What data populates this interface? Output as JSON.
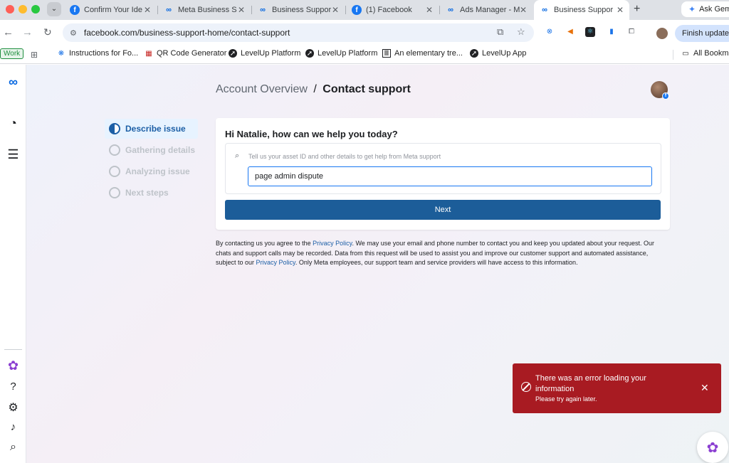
{
  "browser": {
    "tabs": [
      {
        "title": "Confirm Your Ide",
        "icon": "facebook-icon"
      },
      {
        "title": "Meta Business S",
        "icon": "meta-icon"
      },
      {
        "title": "Business Suppor",
        "icon": "meta-icon"
      },
      {
        "title": "(1) Facebook",
        "icon": "facebook-icon"
      },
      {
        "title": "Ads Manager - M",
        "icon": "meta-icon"
      },
      {
        "title": "Business Suppor",
        "icon": "meta-icon",
        "active": true
      }
    ],
    "ask_label": "Ask Gem",
    "url": "facebook.com/business-support-home/contact-support",
    "finish_update": "Finish update",
    "bookmarks": [
      {
        "label": "Work"
      },
      {
        "label": "Instructions for Fo..."
      },
      {
        "label": "QR Code Generator"
      },
      {
        "label": "LevelUp Platform"
      },
      {
        "label": "LevelUp Platform"
      },
      {
        "label": "An elementary tre..."
      },
      {
        "label": "LevelUp App"
      },
      {
        "label": "All Bookma"
      }
    ]
  },
  "page": {
    "breadcrumb_parent": "Account Overview",
    "breadcrumb_sep": "/",
    "breadcrumb_current": "Contact support",
    "steps": [
      {
        "label": "Describe issue",
        "active": true
      },
      {
        "label": "Gathering details",
        "active": false
      },
      {
        "label": "Analyzing issue",
        "active": false
      },
      {
        "label": "Next steps",
        "active": false
      }
    ],
    "card_title": "Hi Natalie, how can we help you today?",
    "search_hint": "Tell us your asset ID and other details to get help from Meta support",
    "search_value": "page admin dispute",
    "next_label": "Next",
    "disclaimer": {
      "part1": "By contacting us you agree to the ",
      "link1": "Privacy Policy",
      "part2": ". We may use your email and phone number to contact you and keep you updated about your request. Our chats and support calls may be recorded. Data from this request will be used to assist you and improve our customer support and automated assistance, subject to our ",
      "link2": "Privacy Policy",
      "part3": ". Only Meta employees, our support team and service providers will have access to this information."
    },
    "toast": {
      "title": "There was an error loading your information",
      "subtitle": "Please try again later."
    }
  },
  "colors": {
    "primary": "#1c5d99",
    "error": "#a81b22",
    "link": "#1c5fa6"
  }
}
